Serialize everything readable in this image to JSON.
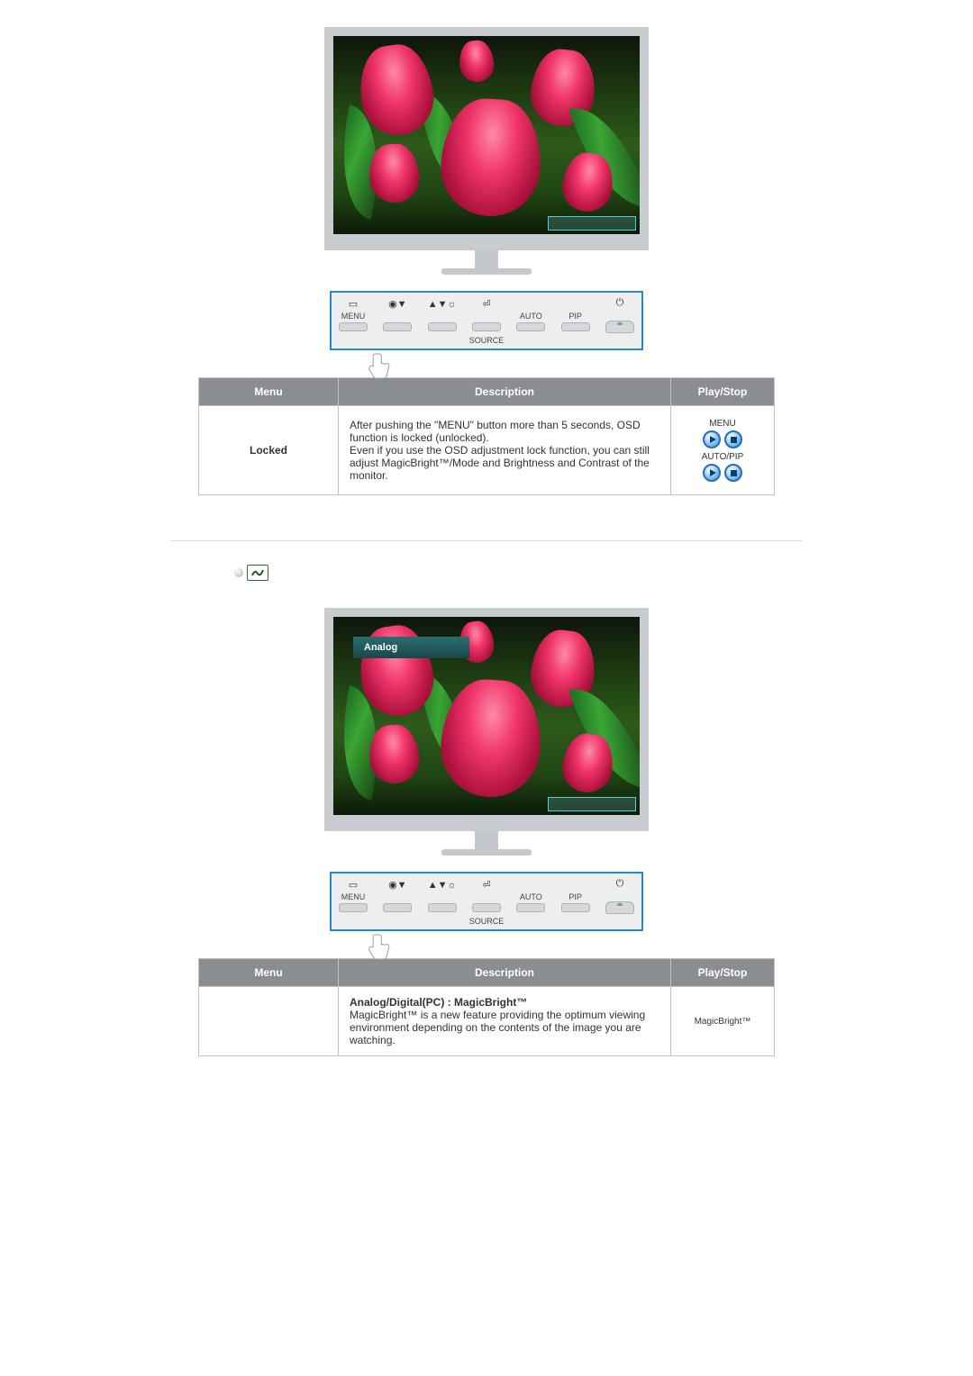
{
  "controlPanel": {
    "menu": "MENU",
    "auto": "AUTO",
    "pip": "PIP",
    "source": "SOURCE",
    "modeIcon": "◉▼",
    "brightIcon": "▲▼☼",
    "enterIcon": "⏎",
    "powerIcon": "⏻"
  },
  "table1": {
    "headers": {
      "menu": "Menu",
      "description": "Description",
      "play": "Play/Stop"
    },
    "row": {
      "menu": "Locked",
      "description": "After pushing the \"MENU\" button more than 5 seconds, OSD function is locked (unlocked).\nEven if you use the OSD adjustment lock function, you can still adjust MagicBright™/Mode and Brightness and Contrast of the monitor.",
      "play": {
        "label1": "MENU",
        "label2": "AUTO/PIP"
      }
    }
  },
  "osd": {
    "analogLabel": "Analog"
  },
  "table2": {
    "headers": {
      "menu": "Menu",
      "description": "Description",
      "play": "Play/Stop"
    },
    "row": {
      "menu": "",
      "descTitle": "Analog/Digital(PC) : MagicBright™",
      "descBody": "MagicBright™ is a new feature providing the optimum viewing environment depending on the contents of the image you are watching.",
      "play": {
        "label1": "MagicBright™"
      }
    }
  }
}
